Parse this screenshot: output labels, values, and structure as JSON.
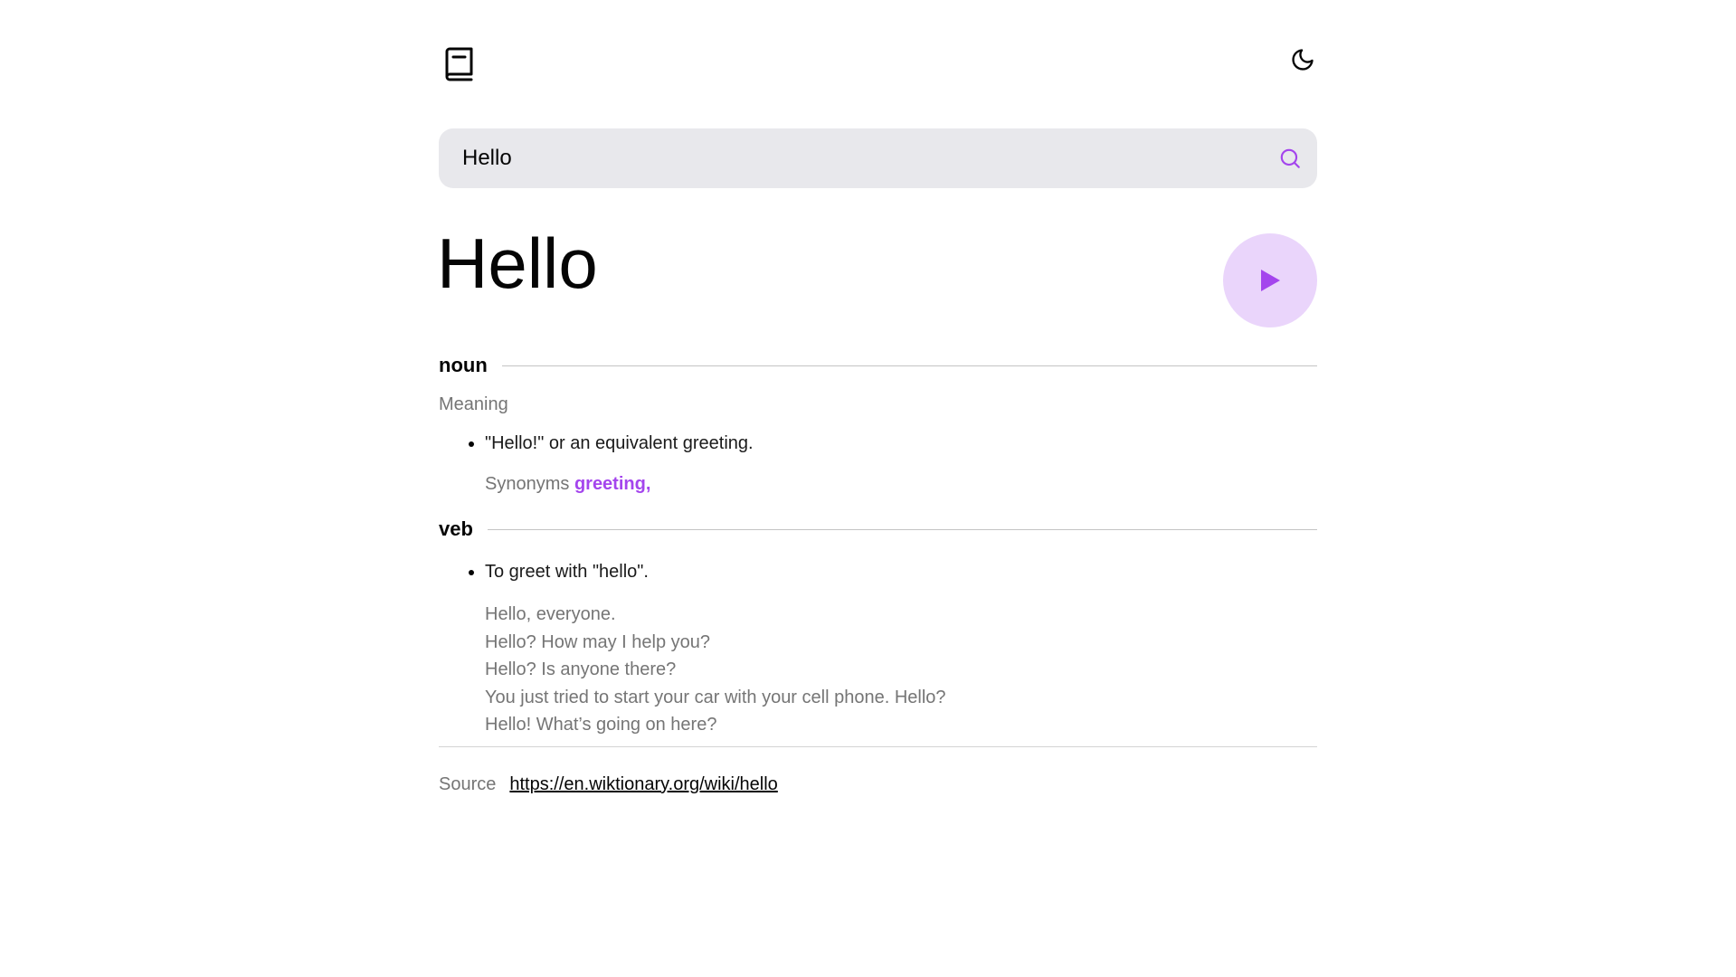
{
  "header": {
    "logo_icon": "book-icon",
    "theme_toggle_icon": "moon-icon"
  },
  "search": {
    "value": "Hello",
    "icon": "search-icon"
  },
  "entry": {
    "word": "Hello",
    "play_icon": "play-icon",
    "meanings": [
      {
        "part_of_speech": "noun",
        "label": "Meaning",
        "definitions": [
          "\"Hello!\" or an equivalent greeting."
        ],
        "synonyms_label": "Synonyms",
        "synonyms": "greeting,"
      },
      {
        "part_of_speech": "veb",
        "definitions": [
          "To greet with \"hello\"."
        ],
        "examples": [
          "Hello, everyone.",
          "Hello? How may I help you?",
          "Hello? Is anyone there?",
          "You just tried to start your car with your cell phone. Hello?",
          "Hello! What’s going on here?"
        ]
      }
    ]
  },
  "source": {
    "label": "Source",
    "url": "https://en.wiktionary.org/wiki/hello"
  },
  "colors": {
    "accent": "#a445ed",
    "play_bg": "#ead5fb",
    "search_bg": "#e8e8ec",
    "muted_text": "#757575"
  }
}
